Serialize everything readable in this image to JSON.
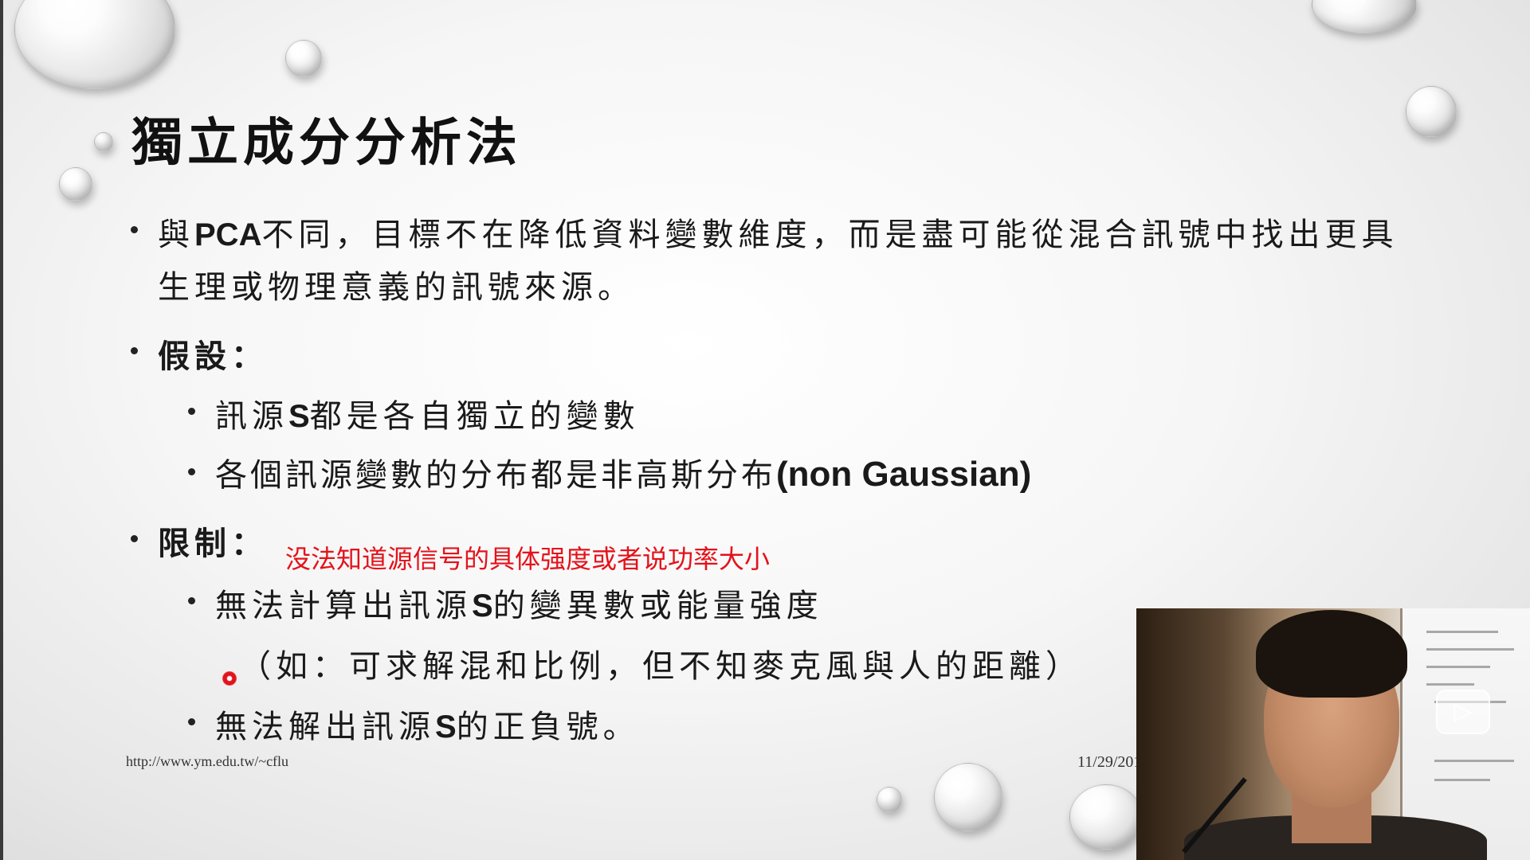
{
  "slide": {
    "title": "獨立成分分析法",
    "intro": {
      "pre": "與",
      "bold": "PCA",
      "post": "不同，目標不在降低資料變數維度，而是盡可能從混合訊號中找出更具",
      "line2": "生理或物理意義的訊號來源。"
    },
    "assumptions": {
      "heading": "假設：",
      "items": [
        {
          "pre": "訊源",
          "bold": "S",
          "post": "都是各自獨立的變數"
        },
        {
          "pre": "各個訊源變數的分布都是非高斯分布",
          "bold": "(non Gaussian)"
        }
      ]
    },
    "limitations": {
      "heading": "限制：",
      "items": [
        {
          "pre": "無法計算出訊源",
          "bold": "S",
          "post": "的變異數或能量強度",
          "note": "（如：可求解混和比例，但不知麥克風與人的距離）"
        },
        {
          "pre": "無法解出訊源",
          "bold": "S",
          "post": "的正負號。"
        }
      ]
    },
    "footer_url": "http://www.ym.edu.tw/~cflu",
    "footer_date": "11/29/201"
  },
  "annotation": {
    "text": "没法知道源信号的具体强度或者说功率大小",
    "color": "#e4121b"
  },
  "webcam": {
    "badge_icon": "play-icon"
  }
}
